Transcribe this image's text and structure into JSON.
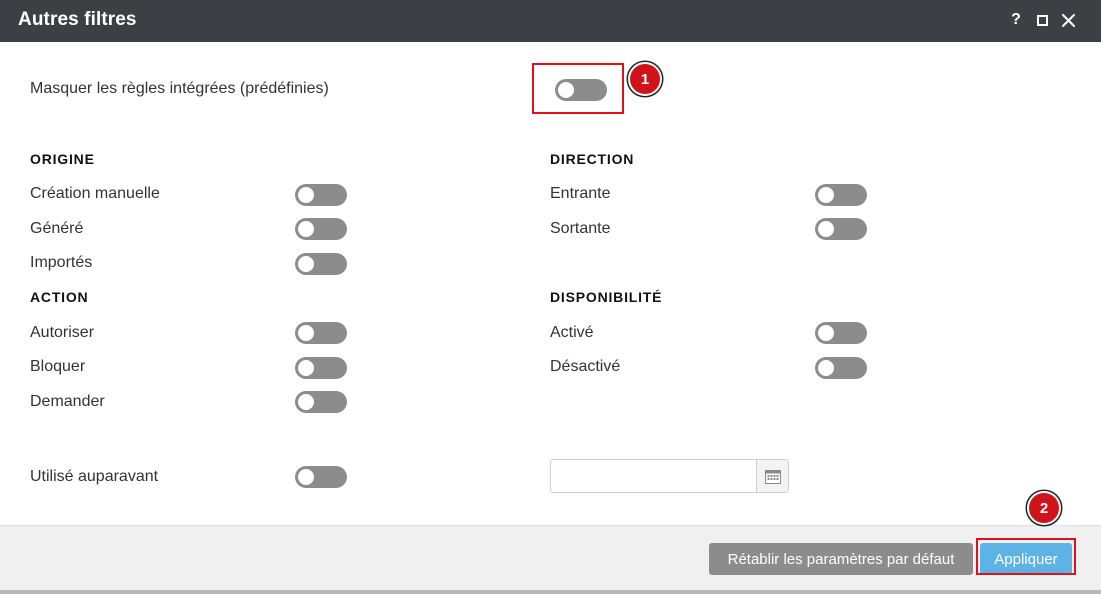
{
  "window": {
    "title": "Autres filtres",
    "help_label": "?"
  },
  "hide_builtin": {
    "label": "Masquer les règles intégrées (prédéfinies)",
    "enabled": false
  },
  "sections": {
    "origine": {
      "header": "ORIGINE",
      "items": [
        {
          "label": "Création manuelle",
          "enabled": false
        },
        {
          "label": "Généré",
          "enabled": false
        },
        {
          "label": "Importés",
          "enabled": false
        }
      ]
    },
    "direction": {
      "header": "DIRECTION",
      "items": [
        {
          "label": "Entrante",
          "enabled": false
        },
        {
          "label": "Sortante",
          "enabled": false
        }
      ]
    },
    "action": {
      "header": "ACTION",
      "items": [
        {
          "label": "Autoriser",
          "enabled": false
        },
        {
          "label": "Bloquer",
          "enabled": false
        },
        {
          "label": "Demander",
          "enabled": false
        }
      ]
    },
    "disponibilite": {
      "header": "DISPONIBILITÉ",
      "items": [
        {
          "label": "Activé",
          "enabled": false
        },
        {
          "label": "Désactivé",
          "enabled": false
        }
      ]
    }
  },
  "used_before": {
    "label": "Utilisé auparavant",
    "enabled": false,
    "date_value": "",
    "date_placeholder": ""
  },
  "footer": {
    "reset_label": "Rétablir les paramètres par défaut",
    "apply_label": "Appliquer"
  },
  "callouts": {
    "marker_1": "1",
    "marker_2": "2"
  },
  "colors": {
    "titlebar": "#3c4045",
    "toggle_off": "#8c8c8c",
    "apply_button": "#5db3e6",
    "reset_button": "#8c8c8c",
    "highlight": "#e0101c"
  }
}
